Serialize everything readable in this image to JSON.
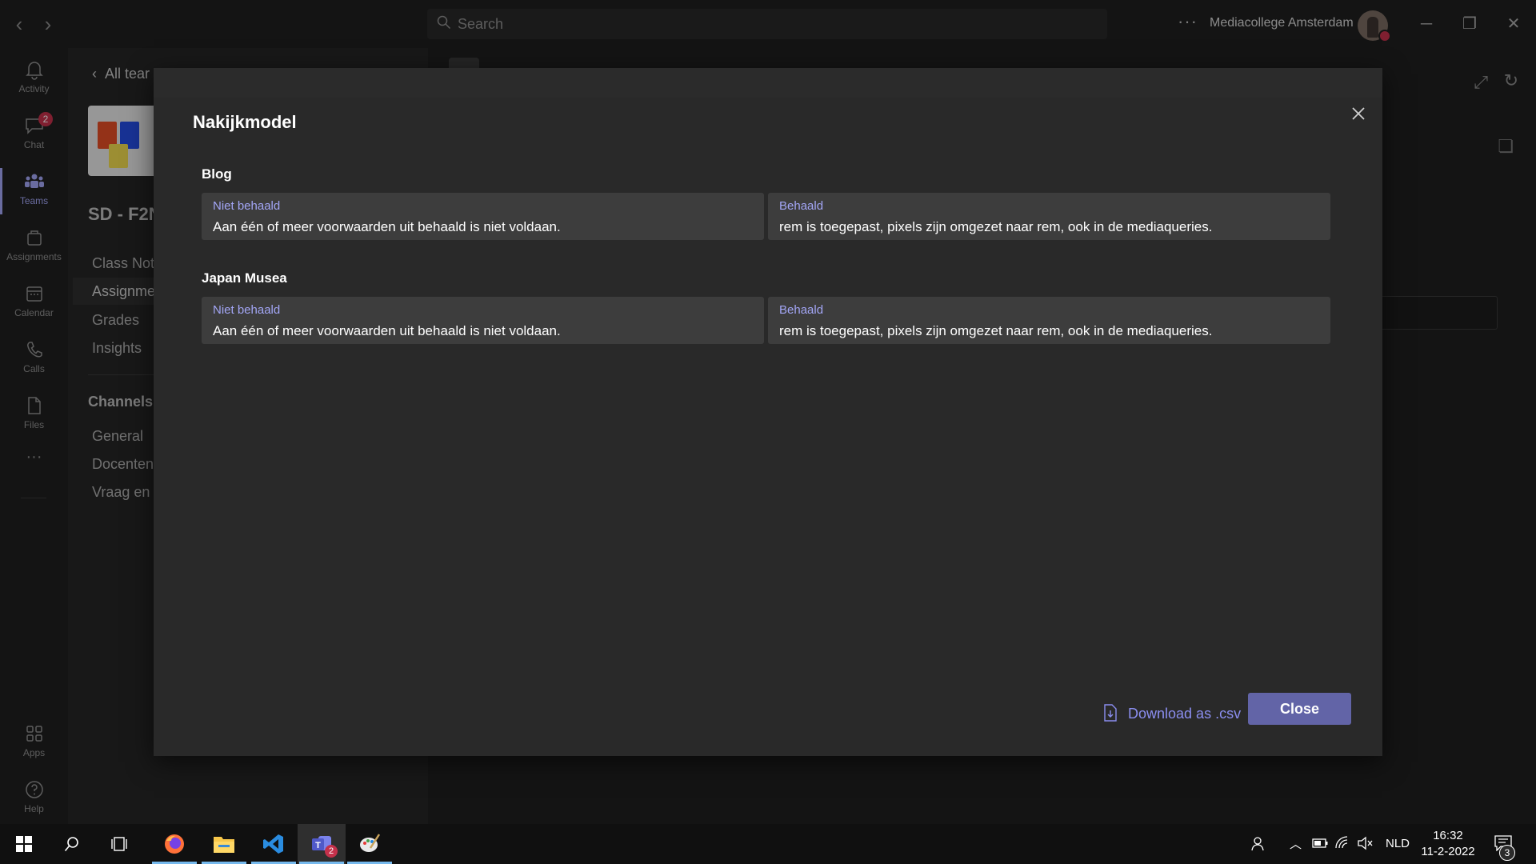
{
  "titlebar": {
    "search_placeholder": "Search",
    "more_label": "···",
    "org_name": "Mediacollege Amsterdam"
  },
  "rail": {
    "items": [
      {
        "label": "Activity",
        "icon": "bell-icon"
      },
      {
        "label": "Chat",
        "icon": "chat-icon",
        "badge": "2"
      },
      {
        "label": "Teams",
        "icon": "teams-icon",
        "active": true
      },
      {
        "label": "Assignments",
        "icon": "assignments-icon"
      },
      {
        "label": "Calendar",
        "icon": "calendar-icon"
      },
      {
        "label": "Calls",
        "icon": "phone-icon"
      },
      {
        "label": "Files",
        "icon": "file-icon"
      }
    ],
    "more_label": "···",
    "apps_label": "Apps",
    "help_label": "Help"
  },
  "teamside": {
    "back_label": "All tear",
    "team_name": "SD - F2N",
    "links": [
      "Class Note",
      "Assignmer",
      "Grades",
      "Insights"
    ],
    "channels_heading": "Channels",
    "channels": [
      "General",
      "Docenten",
      "Vraag en a"
    ]
  },
  "dialog": {
    "title": "Nakijkmodel",
    "sections": [
      {
        "title": "Blog",
        "levels": [
          {
            "level": "Niet behaald",
            "description": "Aan één of meer voorwaarden uit behaald is niet voldaan."
          },
          {
            "level": "Behaald",
            "description": "rem is toegepast, pixels zijn omgezet naar rem, ook in de mediaqueries."
          }
        ]
      },
      {
        "title": "Japan Musea",
        "levels": [
          {
            "level": "Niet behaald",
            "description": "Aan één of meer voorwaarden uit behaald is niet voldaan."
          },
          {
            "level": "Behaald",
            "description": "rem is toegepast, pixels zijn omgezet naar rem, ook in de mediaqueries."
          }
        ]
      }
    ],
    "download_label": "Download as .csv",
    "close_label": "Close"
  },
  "taskbar": {
    "teams_badge": "2",
    "language": "NLD",
    "time": "16:32",
    "date": "11-2-2022",
    "notifications": "3"
  },
  "colors": {
    "accent": "#6264a7",
    "accent_text": "#a3a6f6",
    "link": "#8b8ef0",
    "dialog_bg": "#292929",
    "card_bg": "#3d3d3d"
  }
}
